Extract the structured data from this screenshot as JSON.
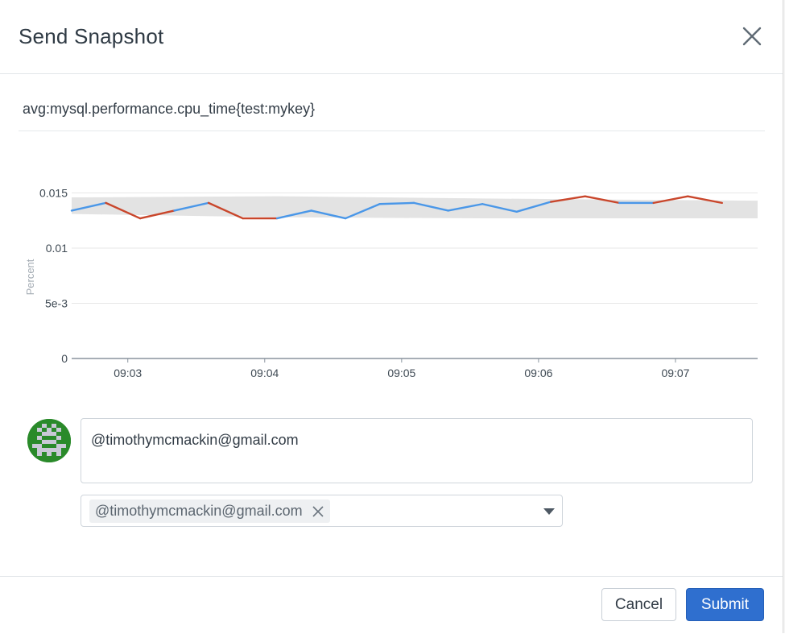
{
  "modal": {
    "title": "Send Snapshot",
    "query": "avg:mysql.performance.cpu_time{test:mykey}"
  },
  "chart_data": {
    "type": "line",
    "ylabel": "Percent",
    "ylim": [
      0,
      0.0165
    ],
    "y_ticks": [
      "0",
      "5e-3",
      "0.01",
      "0.015"
    ],
    "y_tick_values": [
      0,
      0.005,
      0.01,
      0.015
    ],
    "x_ticks": [
      "09:03",
      "09:04",
      "09:05",
      "09:06",
      "09:07"
    ],
    "x_range_minutes": [
      2.59,
      7.6
    ],
    "grid": true,
    "colors": {
      "line": "#4a97e8",
      "anomaly": "#c9462b",
      "band": "#e3e3e3",
      "axis": "#8a949e",
      "grid": "#e7e7e7"
    },
    "series": [
      {
        "x": [
          2.59,
          2.84,
          3.09,
          3.34,
          3.59,
          3.84,
          4.09,
          4.34,
          4.59,
          4.84,
          5.09,
          5.34,
          5.59,
          5.84,
          6.09,
          6.34,
          6.59,
          6.84,
          7.09,
          7.34
        ],
        "values": [
          0.0134,
          0.0141,
          0.0127,
          0.0134,
          0.0141,
          0.0127,
          0.0127,
          0.0134,
          0.0127,
          0.014,
          0.0141,
          0.0134,
          0.014,
          0.0133,
          0.0142,
          0.0147,
          0.0141,
          0.0141,
          0.0147,
          0.0141
        ],
        "anomaly_segments": [
          [
            1,
            3
          ],
          [
            4,
            6
          ],
          [
            14,
            16
          ],
          [
            17,
            19
          ]
        ]
      }
    ],
    "band": {
      "x": [
        2.59,
        4.09,
        5.59,
        7.6
      ],
      "upper": [
        0.0146,
        0.0147,
        0.0145,
        0.0143
      ],
      "lower": [
        0.0131,
        0.0128,
        0.0127,
        0.0127
      ]
    }
  },
  "comment": {
    "avatar": "user-avatar",
    "text": "@timothymcmackin@gmail.com"
  },
  "recipients": {
    "chips": [
      "@timothymcmackin@gmail.com"
    ]
  },
  "footer": {
    "cancel_label": "Cancel",
    "submit_label": "Submit"
  }
}
